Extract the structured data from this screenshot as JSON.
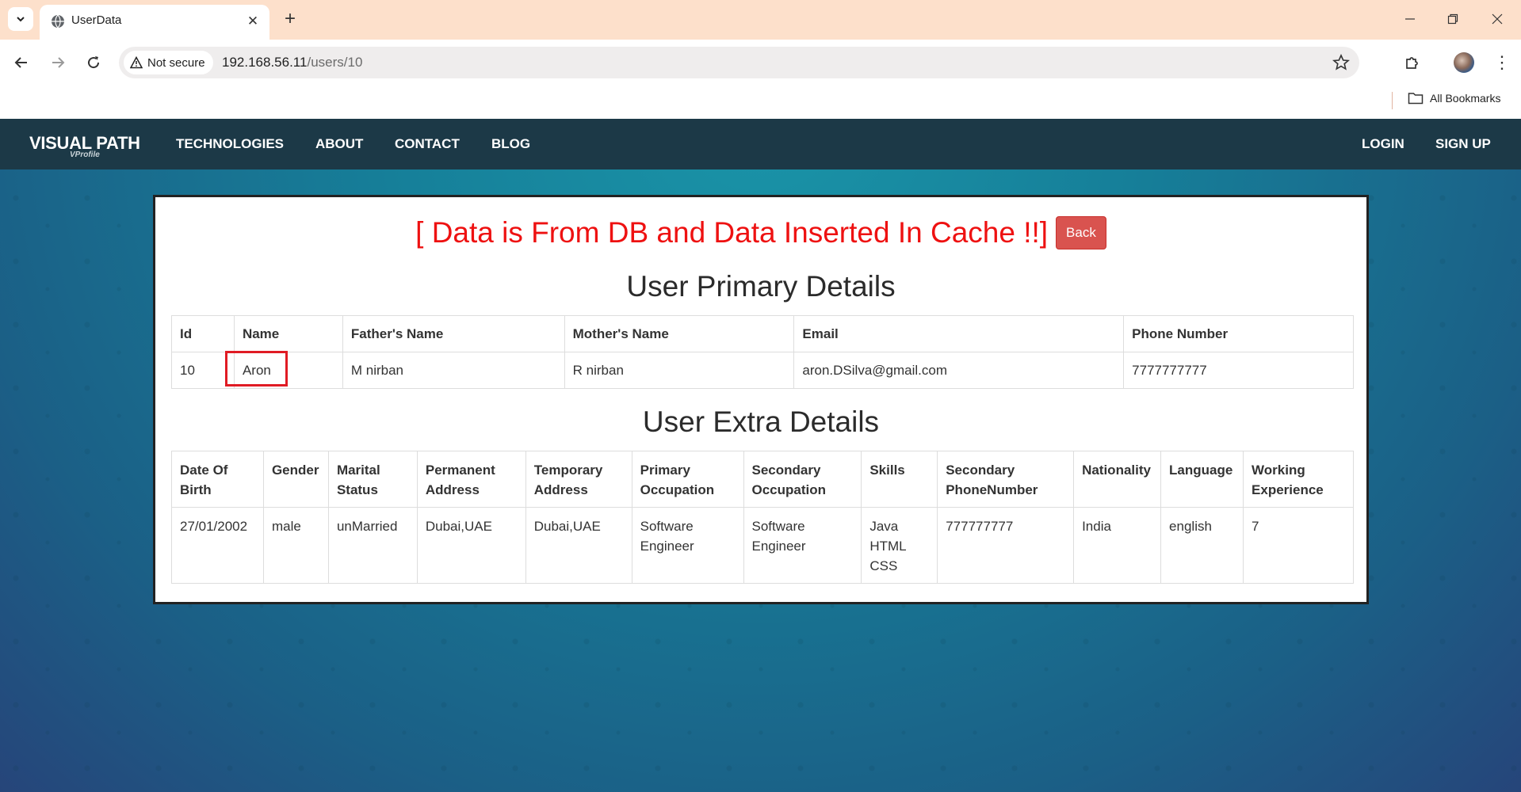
{
  "browser": {
    "tab_title": "UserData",
    "security_label": "Not secure",
    "url_host": "192.168.56.11",
    "url_path": "/users/10",
    "bookmarks_label": "All Bookmarks"
  },
  "navbar": {
    "brand": "VISUAL PATH",
    "brand_sub": "VProfile",
    "links": [
      "TECHNOLOGIES",
      "ABOUT",
      "CONTACT",
      "BLOG"
    ],
    "right_links": [
      "LOGIN",
      "SIGN UP"
    ]
  },
  "main": {
    "message": "[ Data is From DB and Data Inserted In Cache !!]",
    "back_label": "Back",
    "primary_title": "User Primary Details",
    "primary_headers": [
      "Id",
      "Name",
      "Father's Name",
      "Mother's Name",
      "Email",
      "Phone Number"
    ],
    "primary_row": [
      "10",
      "Aron",
      "M nirban",
      "R nirban",
      "aron.DSilva@gmail.com",
      "7777777777"
    ],
    "extra_title": "User Extra Details",
    "extra_headers": [
      "Date Of Birth",
      "Gender",
      "Marital Status",
      "Permanent Address",
      "Temporary Address",
      "Primary Occupation",
      "Secondary Occupation",
      "Skills",
      "Secondary PhoneNumber",
      "Nationality",
      "Language",
      "Working Experience"
    ],
    "extra_row": [
      "27/01/2002",
      "male",
      "unMarried",
      "Dubai,UAE",
      "Dubai,UAE",
      "Software Engineer",
      "Software Engineer",
      "Java HTML CSS",
      "777777777",
      "India",
      "english",
      "7"
    ]
  },
  "colors": {
    "navbar_bg": "#1c3947",
    "message_red": "#ee1111",
    "back_button": "#d9534f",
    "highlight_box": "#e01b24"
  }
}
